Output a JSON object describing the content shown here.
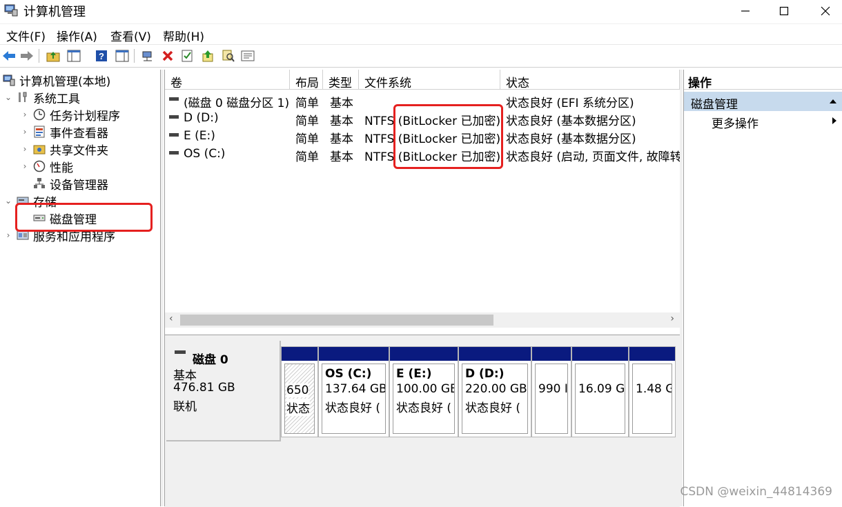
{
  "window": {
    "title": "计算机管理"
  },
  "menu": [
    "文件(F)",
    "操作(A)",
    "查看(V)",
    "帮助(H)"
  ],
  "tree": {
    "root": "计算机管理(本地)",
    "system_tools": "系统工具",
    "task_scheduler": "任务计划程序",
    "event_viewer": "事件查看器",
    "shared_folders": "共享文件夹",
    "performance": "性能",
    "device_manager": "设备管理器",
    "storage": "存储",
    "disk_management": "磁盘管理",
    "services_apps": "服务和应用程序"
  },
  "volumes": {
    "headers": [
      "卷",
      "布局",
      "类型",
      "文件系统",
      "状态"
    ],
    "rows": [
      {
        "name": "(磁盘 0 磁盘分区 1)",
        "layout": "简单",
        "type": "基本",
        "fs": "",
        "status": "状态良好 (EFI 系统分区)"
      },
      {
        "name": "D (D:)",
        "layout": "简单",
        "type": "基本",
        "fs": "NTFS (BitLocker 已加密)",
        "status": "状态良好 (基本数据分区)"
      },
      {
        "name": "E (E:)",
        "layout": "简单",
        "type": "基本",
        "fs": "NTFS (BitLocker 已加密)",
        "status": "状态良好 (基本数据分区)"
      },
      {
        "name": "OS (C:)",
        "layout": "简单",
        "type": "基本",
        "fs": "NTFS (BitLocker 已加密)",
        "status": "状态良好 (启动, 页面文件, 故障转"
      }
    ]
  },
  "disk": {
    "name": "磁盘 0",
    "type": "基本",
    "size": "476.81 GB",
    "state": "联机",
    "partitions": [
      {
        "line1": "650",
        "line2": "状态"
      },
      {
        "title": "OS  (C:)",
        "line1": "137.64 GB",
        "line2": "状态良好 ("
      },
      {
        "title": "E  (E:)",
        "line1": "100.00 GB",
        "line2": "状态良好 ("
      },
      {
        "title": "D  (D:)",
        "line1": "220.00 GB",
        "line2": "状态良好 ("
      },
      {
        "line1": "990 I"
      },
      {
        "line1": "16.09 G"
      },
      {
        "line1": "1.48 G"
      }
    ]
  },
  "actions": {
    "header": "操作",
    "selected": "磁盘管理",
    "more": "更多操作"
  },
  "watermark": "CSDN @weixin_44814369",
  "colors": {
    "highlight": "#e5201f",
    "partition_bar": "#0a1a7f",
    "action_selected": "#c7daed"
  }
}
